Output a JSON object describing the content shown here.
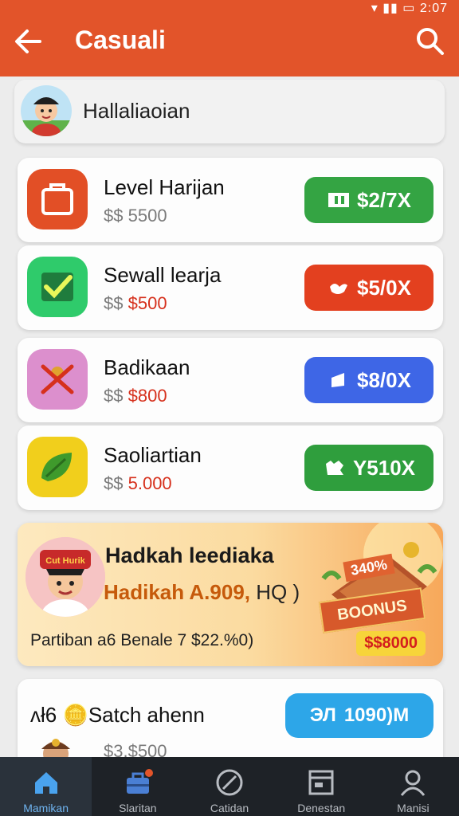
{
  "header": {
    "title": "Casuali",
    "status_text": "▾ ▮▮ ▭ 2:07",
    "color": "#e2542a"
  },
  "user": {
    "name": "Hallaliaoian"
  },
  "tasks": [
    {
      "title": "Level Harijan",
      "amount_prefix": "$$",
      "amount": "5500",
      "reward": "$2/7X",
      "icon": "briefcase-icon",
      "reward_icon": "ticket-icon",
      "color": "#e24f26",
      "button_color": "#34a443"
    },
    {
      "title": "Sewall learja",
      "amount_prefix": "$$",
      "amount": "$500",
      "reward": "$5/0X",
      "icon": "checkmark-icon",
      "reward_icon": "bird-icon",
      "color": "#2fcb6b",
      "button_color": "#e3401f"
    },
    {
      "title": "Badikaan",
      "amount_prefix": "$$",
      "amount": "$800",
      "reward": "$8/0X",
      "icon": "crossed-tool-icon",
      "reward_icon": "card-icon",
      "color": "#dc8fcd",
      "button_color": "#3e66e6"
    },
    {
      "title": "Saoliartian",
      "amount_prefix": "$$",
      "amount": "5.000",
      "reward": "Y510X",
      "icon": "leaf-icon",
      "reward_icon": "puzzle-icon",
      "color": "#f1cf1c",
      "button_color": "#2f9e3d"
    }
  ],
  "bonus": {
    "title": "Hadkah leediaka",
    "sub_highlight": "Hadikah A.909,",
    "sub_rest": "HQ )",
    "footer": "Partiban a6 Benale 7 $22.%0)",
    "badge_top": "340%",
    "banner": "BOONUS",
    "price": "$$8000",
    "avatar_hat_text": "Cut Hurik"
  },
  "last_task": {
    "title": "ʌł6 🪙Satch ahenn",
    "amount": "$3.$500",
    "reward": "1090)M",
    "reward_icon_text": "ЭЛ"
  },
  "nav": [
    {
      "label": "Mamikan",
      "icon": "home-icon",
      "active": true
    },
    {
      "label": "Slaritan",
      "icon": "briefcase-icon",
      "active": false
    },
    {
      "label": "Catidan",
      "icon": "compass-icon",
      "active": false
    },
    {
      "label": "Denestan",
      "icon": "window-icon",
      "active": false
    },
    {
      "label": "Manisi",
      "icon": "person-icon",
      "active": false
    }
  ]
}
